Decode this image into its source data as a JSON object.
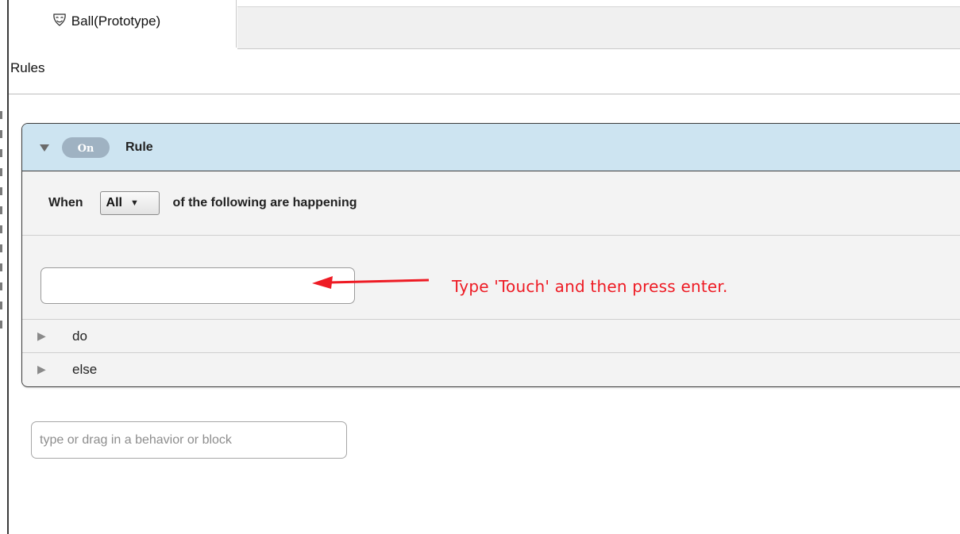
{
  "tab": {
    "title": "Ball(Prototype)",
    "icon": "mask-icon"
  },
  "section": {
    "title": "Rules"
  },
  "rule": {
    "toggle_label": "On",
    "title": "Rule",
    "collapse_icon": "triangle-down-icon",
    "when_label": "When",
    "match_selected": "All",
    "when_suffix": "of the following are happening",
    "condition_input_value": "",
    "do_label": "do",
    "else_label": "else"
  },
  "annotation": {
    "text": "Type 'Touch' and then press enter.",
    "color": "#ee1b24"
  },
  "behavior_input": {
    "placeholder": "type or drag in a behavior or block"
  },
  "colors": {
    "rule_header_bg": "#cde4f1",
    "toggle_bg": "#9fb2c2"
  }
}
